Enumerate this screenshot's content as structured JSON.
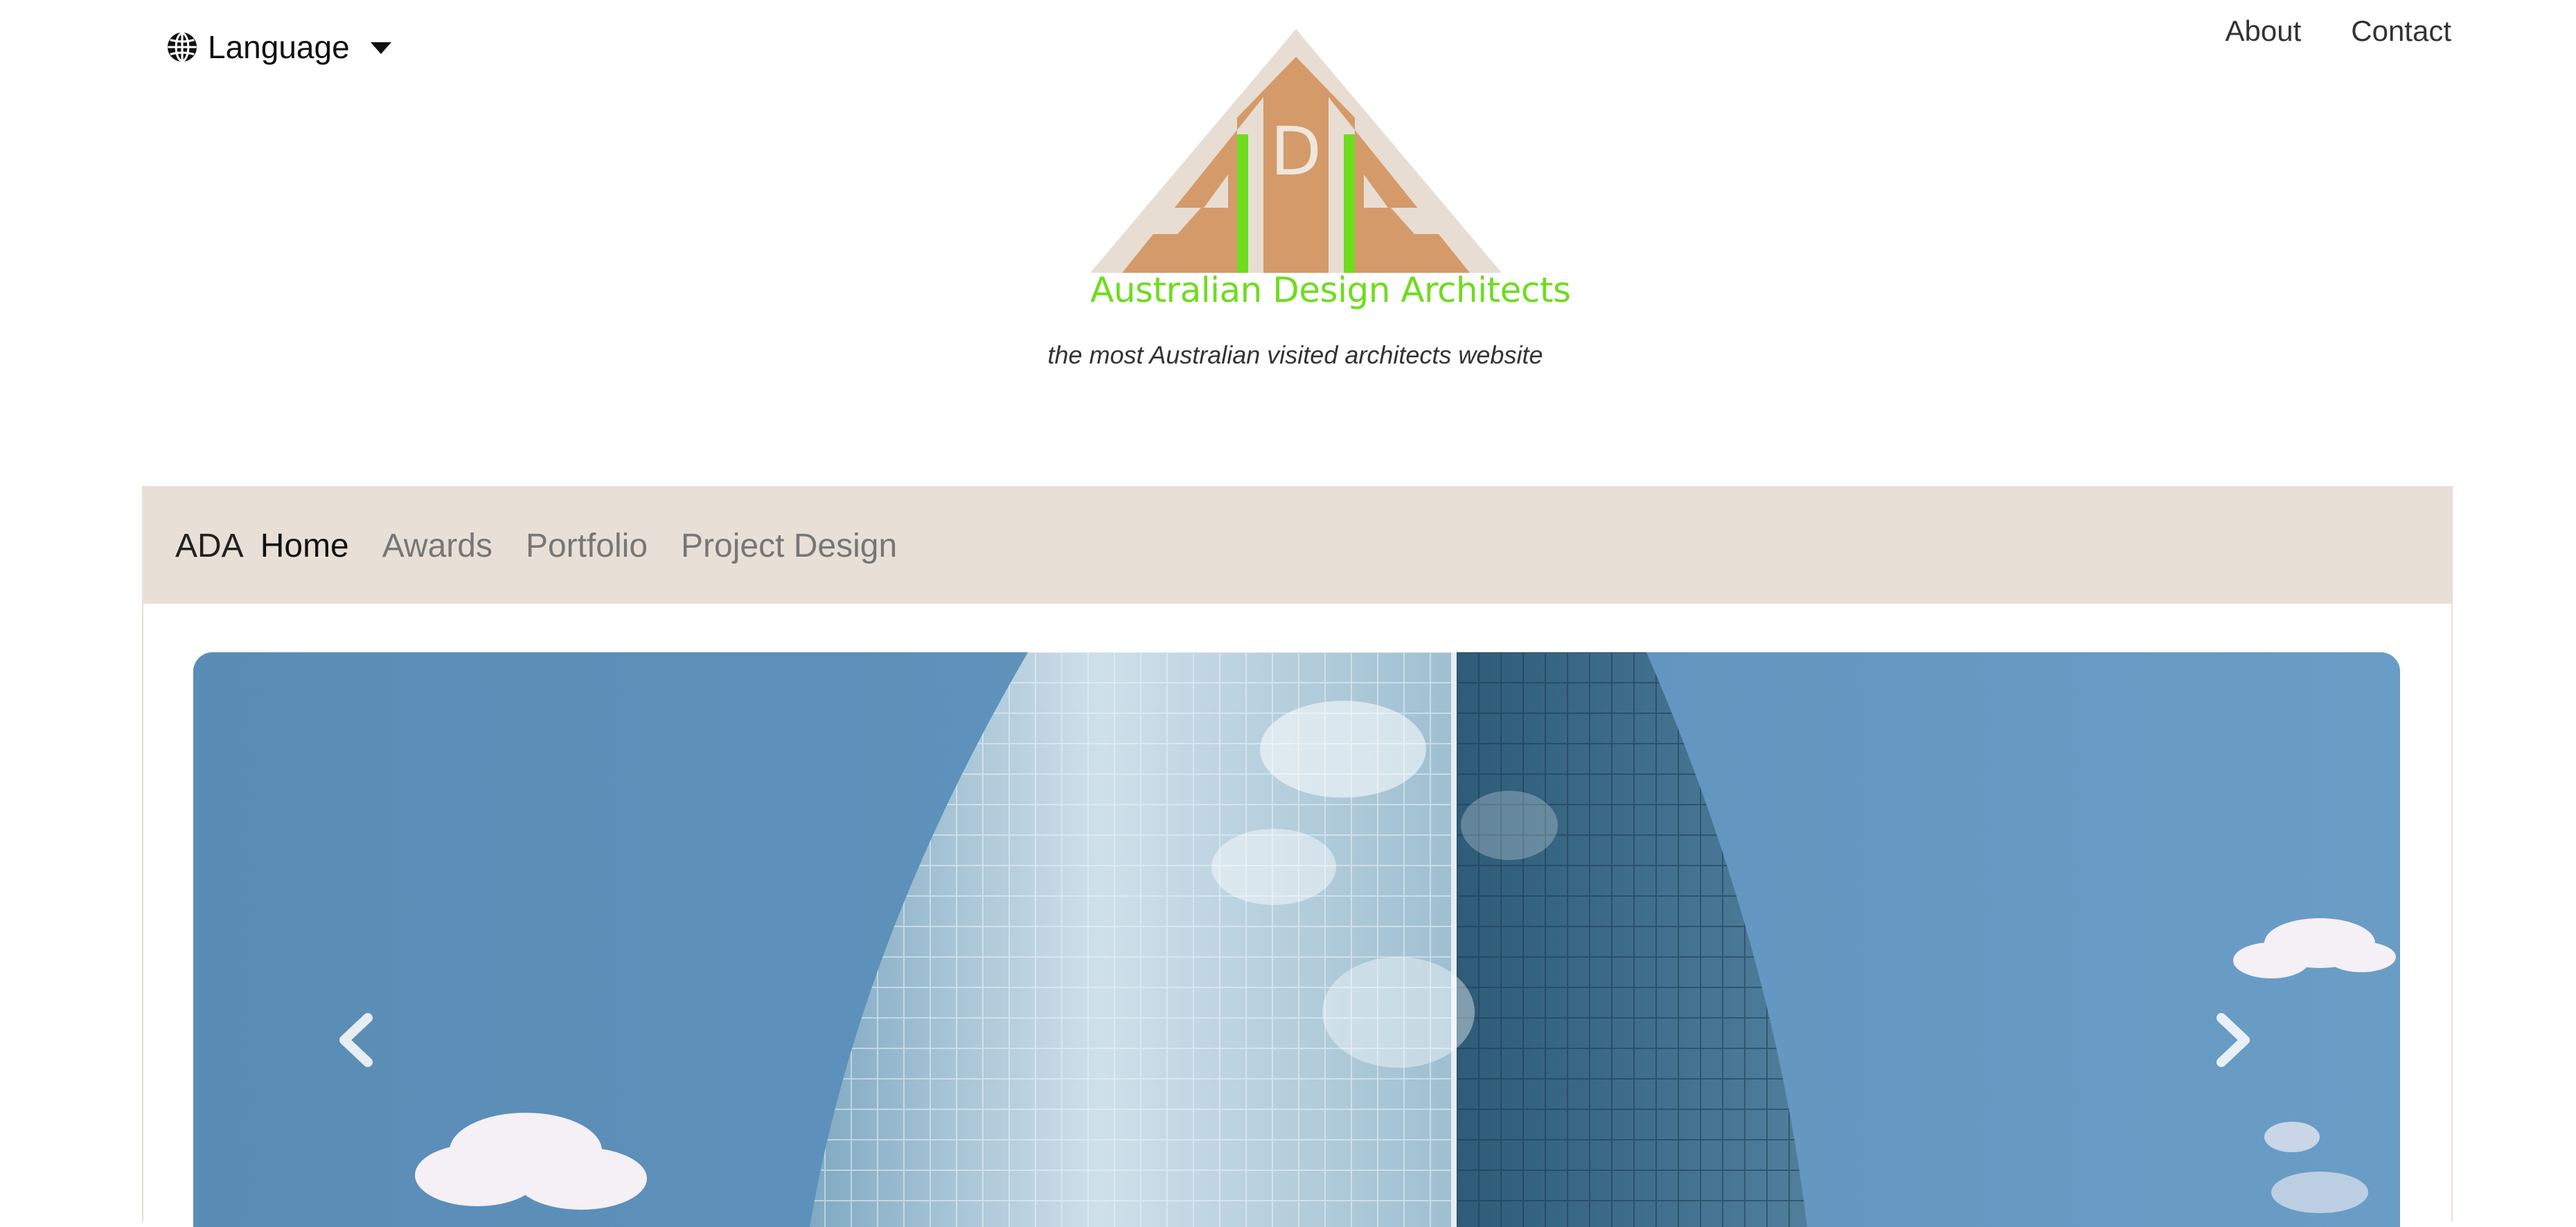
{
  "header": {
    "language_label": "Language",
    "links": [
      {
        "label": "About"
      },
      {
        "label": "Contact"
      }
    ]
  },
  "logo": {
    "mark_letter": "D",
    "brand_name": "Australian Design Architects",
    "colors": {
      "outer": "#e8ddd2",
      "inner": "#d49a6a",
      "accent": "#6fdc1f"
    }
  },
  "tagline": "the most Australian visited architects website",
  "navbar": {
    "brand": "ADA",
    "items": [
      {
        "label": "Home",
        "active": true
      },
      {
        "label": "Awards",
        "active": false
      },
      {
        "label": "Portfolio",
        "active": false
      },
      {
        "label": "Project Design",
        "active": false
      }
    ],
    "background": "#e8e0d7"
  },
  "carousel": {
    "slide_image": "glass skyscraper against blue sky",
    "prev_icon": "chevron-left-icon",
    "next_icon": "chevron-right-icon"
  }
}
